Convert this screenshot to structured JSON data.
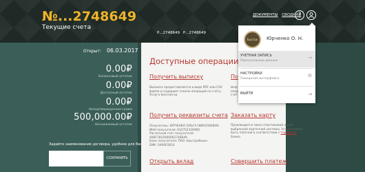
{
  "header": {
    "account_number": "№...2748649",
    "subtitle": "Текущие счета",
    "links": [
      "ДОКУМЕНТЫ",
      "СВОДНАЯ"
    ],
    "help_icon": "?",
    "user_icon": "user-icon"
  },
  "tabs": [
    "Р...2748649",
    "Р...2748649"
  ],
  "account": {
    "opened_label": "Открыт:",
    "opened_date": "06.03.2017",
    "balances": [
      {
        "amount": "0.00₽",
        "label": "Балансовый остаток"
      },
      {
        "amount": "0.00₽",
        "label": "Доступный остаток"
      },
      {
        "amount": "0.00₽",
        "label": "Неподтвержденная сумма"
      },
      {
        "amount": "500,000.00₽",
        "label": "Неснижаемый остаток"
      }
    ]
  },
  "search": {
    "label": "Задайте наименование договора, удобное для Вас:",
    "placeholder": "",
    "button": "СОХРАНИТЬ"
  },
  "operations": {
    "title": "Доступные операции",
    "items": [
      {
        "link": "Получить выписку",
        "desc": [
          "Выписка предоставляется в виде PDF или CSV",
          "файла и содержит список операций по счету.",
          "Услуга бесплатна."
        ]
      },
      {
        "link": "Получить реквизиты счета",
        "desc": [
          "Получатель: ЮРЧЕНКО ОЛЬГА НИКОЛАЕВНА",
          "ИНН получателя: 632702326960",
          "Расчетный счет получателя:",
          "40817810000002748649",
          "Банк получателя: ПАО «Быстробанк»",
          "БИК: 049401814"
        ]
      },
      {
        "link": "Открыть вклад",
        "desc": []
      }
    ],
    "right_items": [
      {
        "link": "Пол",
        "desc": [
          "Инф",
          "опер",
          "счет"
        ]
      },
      {
        "link": "Заказать карту",
        "desc_parts": [
          "Производится заказ пластиковой карты",
          "выбранной карточной системы. Услуга может",
          "быть платной в соответствии с ",
          "тарифами",
          "Банка."
        ]
      },
      {
        "link": "Совершить платеж",
        "desc": []
      }
    ]
  },
  "user_menu": {
    "avatar_text": "Быстро банк",
    "user_name": "Юрченко О. Н.",
    "items": [
      {
        "title": "УЧЕТНАЯ ЗАПИСЬ",
        "subtitle": "Персональные данные",
        "active": true
      },
      {
        "title": "НАСТРОЙКИ",
        "subtitle": "Поведение интерфейса",
        "active": false
      },
      {
        "title": "ВЫЙТИ",
        "subtitle": "",
        "active": false
      }
    ]
  },
  "colors": {
    "accent_gold": "#f0b429",
    "accent_red": "#b5362e",
    "teal_panel": "#3b5e58",
    "header_dark": "#1f2a26"
  }
}
